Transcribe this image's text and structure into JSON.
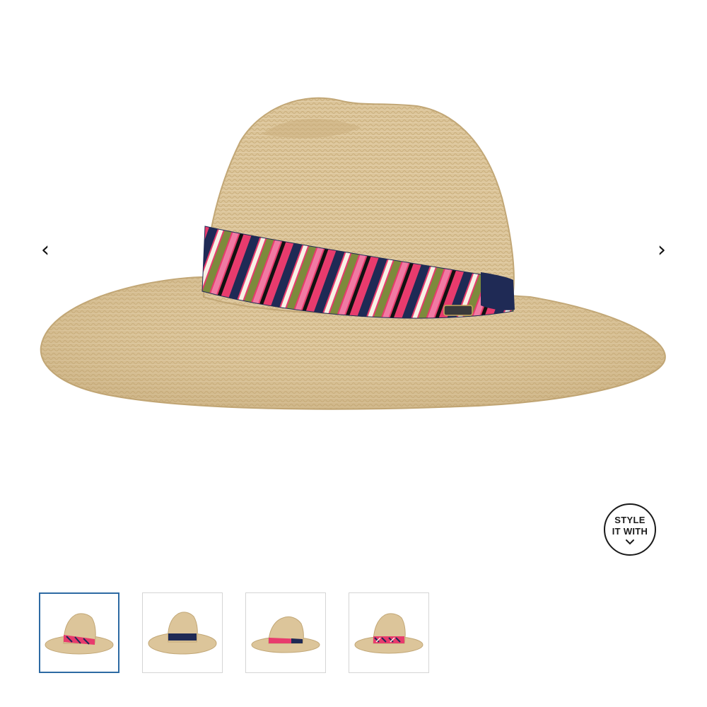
{
  "gallery": {
    "prev_icon": "chevron-left-icon",
    "next_icon": "chevron-right-icon",
    "prev_glyph": "‹",
    "next_glyph": "›",
    "main_image_alt": "hat-straw-fedora-with-geometric-scarf-band"
  },
  "style_with": {
    "line1": "STYLE",
    "line2": "IT WITH",
    "icon": "chevron-down-icon"
  },
  "thumbnails": [
    {
      "view": "side-with-scarf",
      "active": true
    },
    {
      "view": "back-navy-band",
      "active": false
    },
    {
      "view": "side-band",
      "active": false
    },
    {
      "view": "front-scarf-band",
      "active": false
    }
  ],
  "colors": {
    "straw": "#dcc59a",
    "band_pink": "#e83b6d",
    "band_navy": "#1f2a55",
    "band_olive": "#7d8a3c",
    "active_border": "#2d6aa3"
  }
}
